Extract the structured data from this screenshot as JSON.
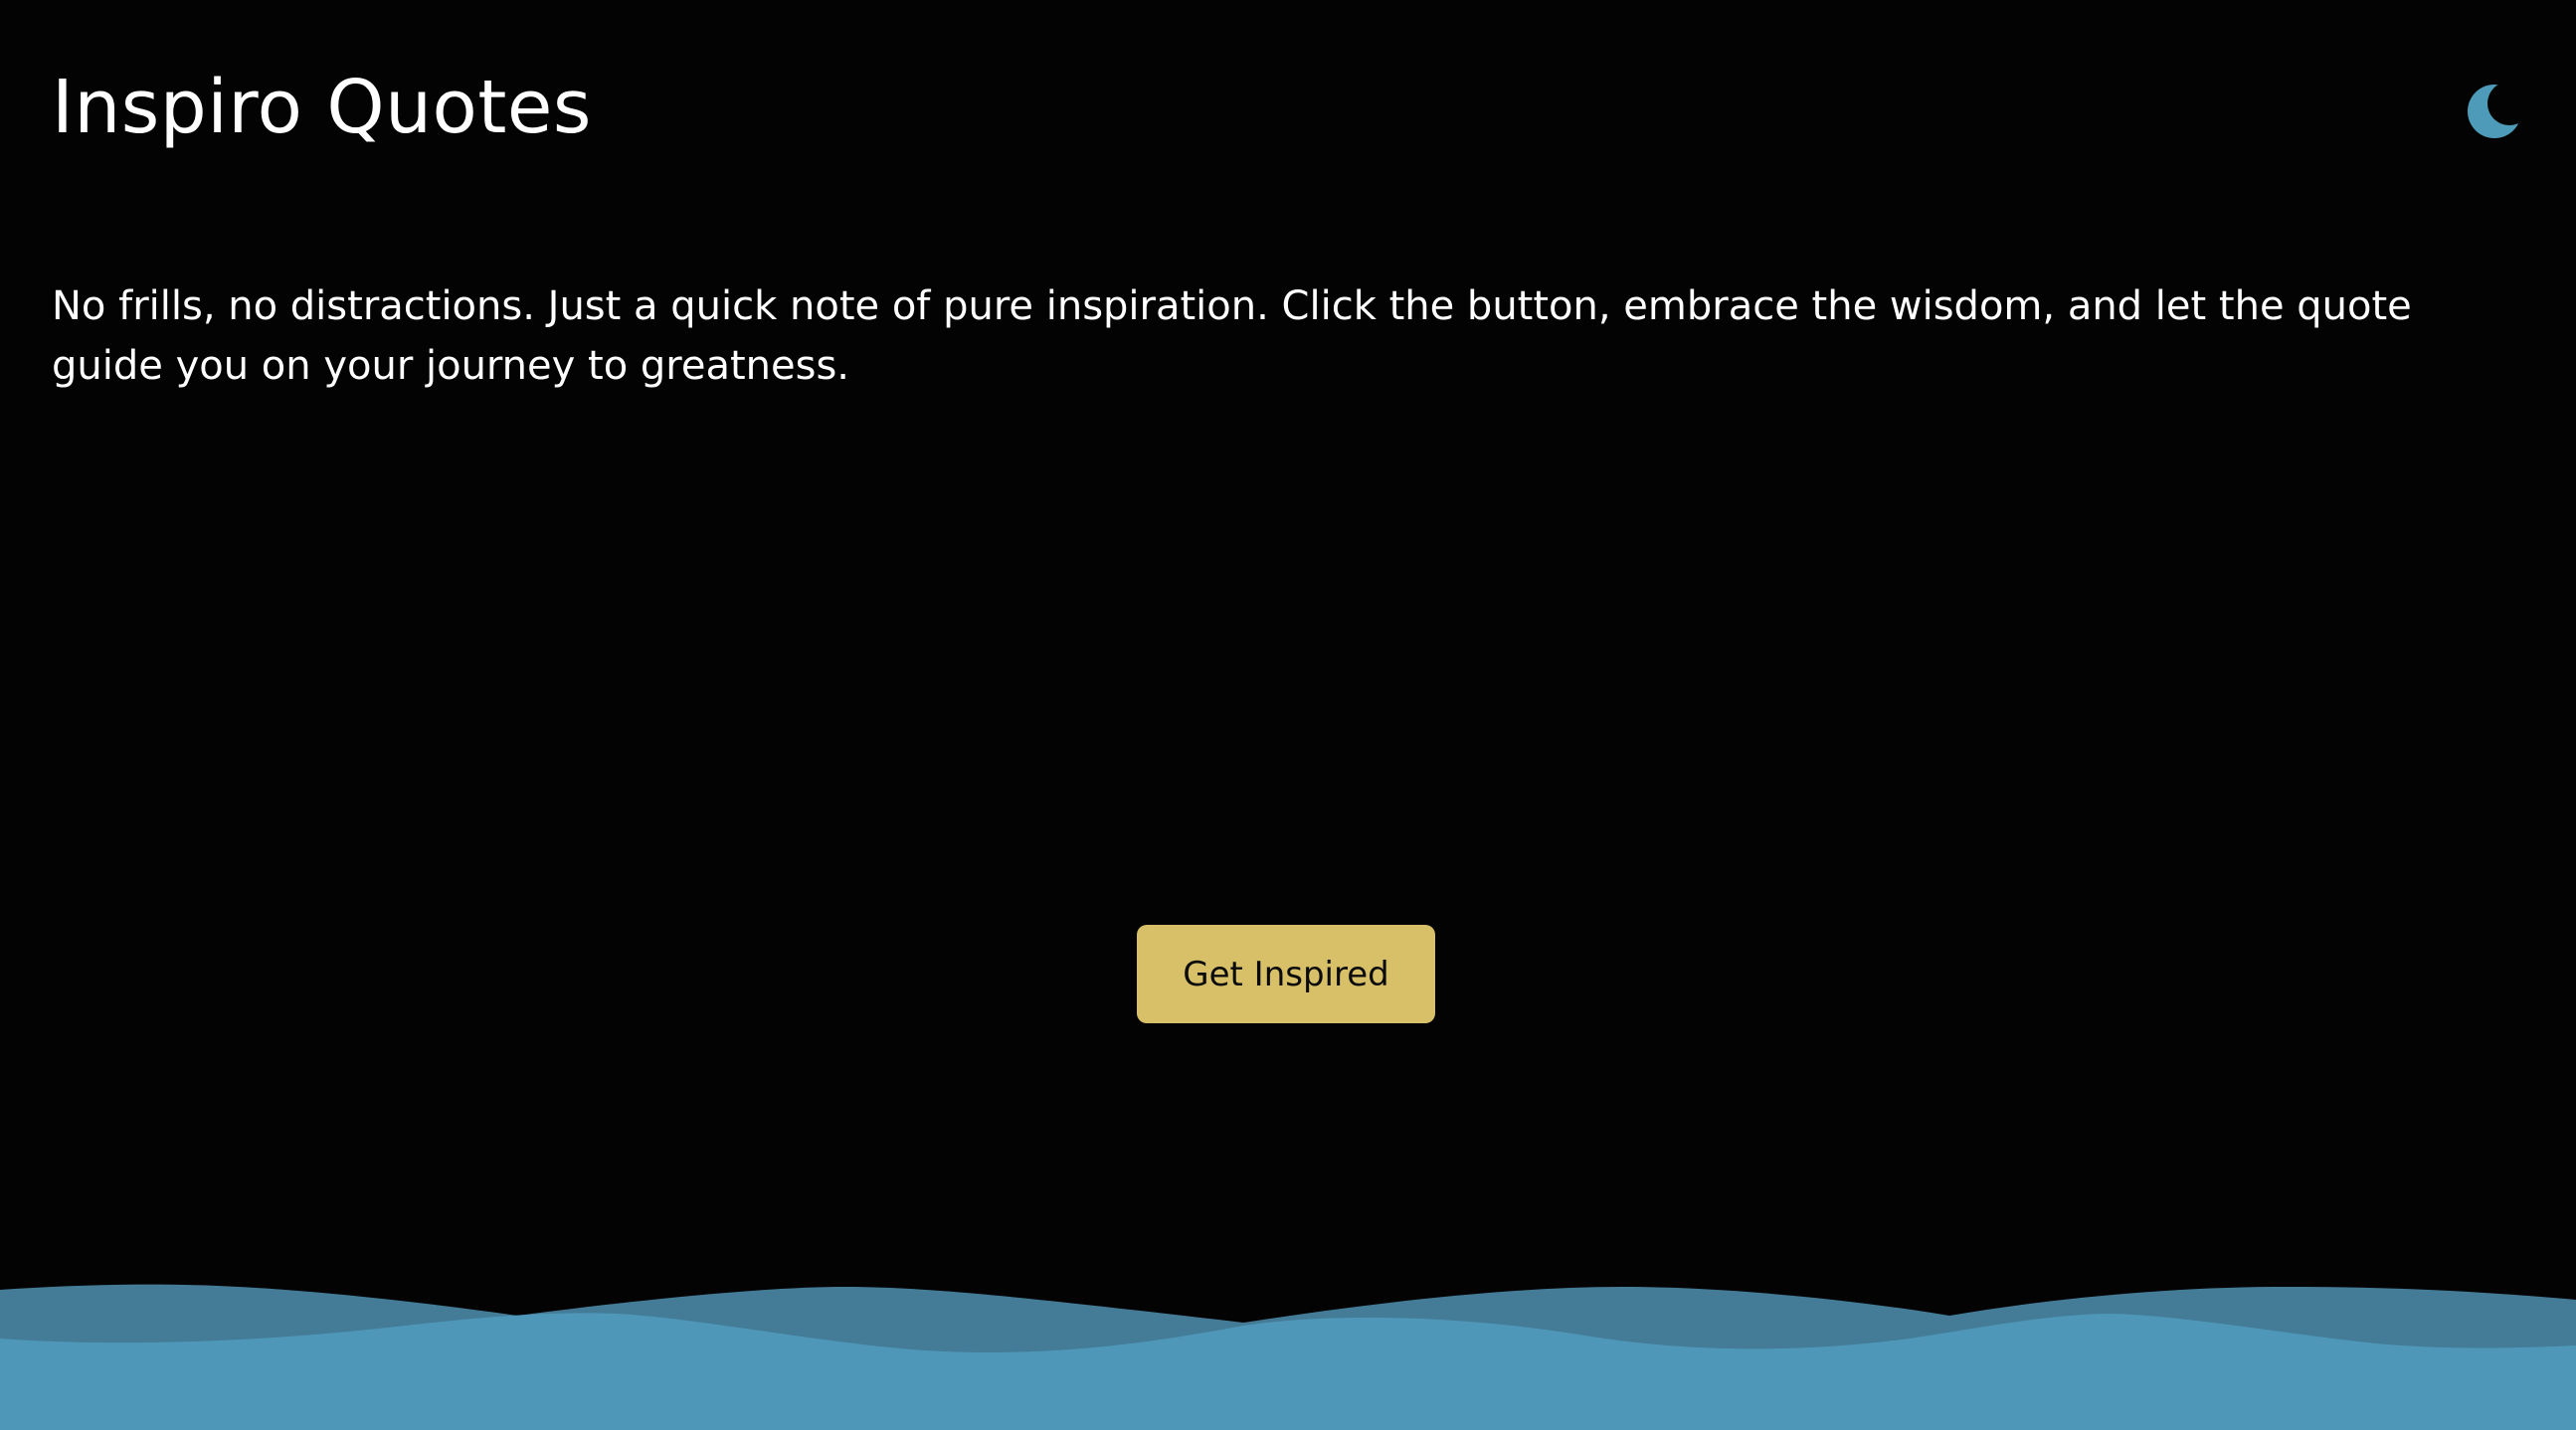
{
  "header": {
    "title": "Inspiro Quotes",
    "theme_toggle_icon": "moon-icon"
  },
  "main": {
    "intro_text": "No frills, no distractions. Just a quick note of pure inspiration. Click the button, embrace the wisdom, and let the quote guide you on your journey to greatness.",
    "button_label": "Get Inspired"
  },
  "colors": {
    "background": "#030303",
    "text": "#ffffff",
    "accent_moon": "#4e9ab9",
    "button": "#d7c068",
    "wave_front": "#4e97b9",
    "wave_back": "#447b96"
  },
  "decor": {
    "footer_decoration": "waves"
  }
}
